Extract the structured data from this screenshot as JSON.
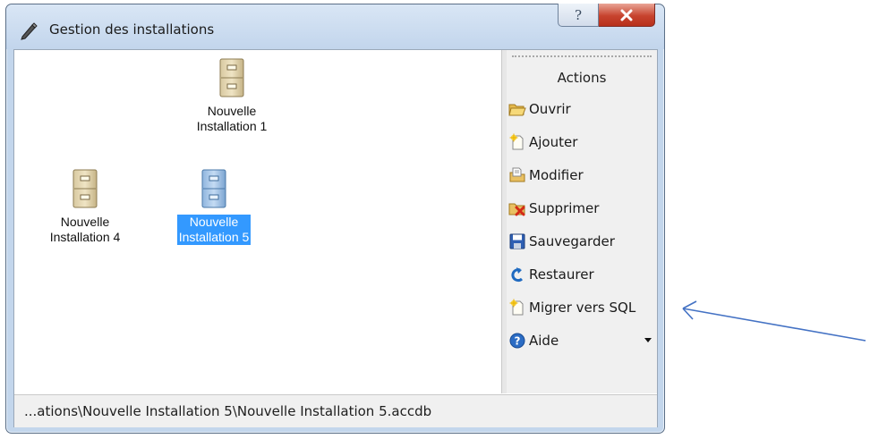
{
  "window": {
    "title": "Gestion des installations",
    "help_glyph": "?",
    "icons": {
      "app": "pencil-icon",
      "help": "help-icon",
      "close": "close-icon"
    }
  },
  "listview": {
    "items": [
      {
        "label": "Nouvelle Installation 1",
        "line1": "Nouvelle",
        "line2": "Installation 1",
        "selected": false,
        "icon": "file-cabinet-icon"
      },
      {
        "label": "Nouvelle Installation 4",
        "line1": "Nouvelle",
        "line2": "Installation 4",
        "selected": false,
        "icon": "file-cabinet-icon"
      },
      {
        "label": "Nouvelle Installation 5",
        "line1": "Nouvelle",
        "line2": "Installation 5",
        "selected": true,
        "icon": "file-cabinet-icon"
      }
    ]
  },
  "actions": {
    "title": "Actions",
    "items": [
      {
        "label": "Ouvrir",
        "icon": "open-folder-icon"
      },
      {
        "label": "Ajouter",
        "icon": "new-document-icon"
      },
      {
        "label": "Modifier",
        "icon": "edit-document-icon"
      },
      {
        "label": "Supprimer",
        "icon": "delete-folder-icon"
      },
      {
        "label": "Sauvegarder",
        "icon": "save-floppy-icon"
      },
      {
        "label": "Restaurer",
        "icon": "restore-arrow-icon"
      },
      {
        "label": "Migrer vers SQL",
        "icon": "new-document-icon"
      },
      {
        "label": "Aide",
        "icon": "help-circle-icon"
      }
    ]
  },
  "statusbar": {
    "path": "...ations\\Nouvelle Installation 5\\Nouvelle Installation 5.accdb"
  },
  "colors": {
    "selection": "#3399ff",
    "annotation_arrow": "#4472c4",
    "frame": "#c3d6ec",
    "close_button": "#c7432e"
  }
}
